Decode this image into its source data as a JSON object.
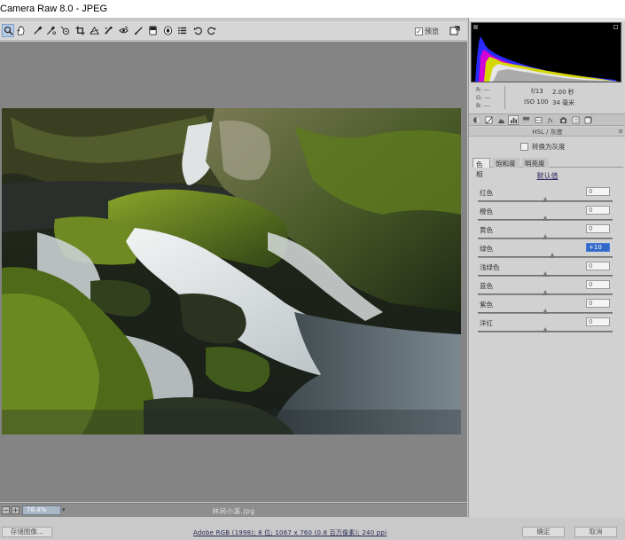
{
  "window": {
    "title": "Camera Raw 8.0 -  JPEG"
  },
  "toolbar": {
    "tools": [
      {
        "name": "zoom-tool",
        "icon": "magnifier-icon",
        "active": true
      },
      {
        "name": "hand-tool",
        "icon": "hand-icon"
      },
      {
        "name": "white-balance-tool",
        "icon": "eyedropper-icon"
      },
      {
        "name": "color-sampler-tool",
        "icon": "color-sampler-icon"
      },
      {
        "name": "targeted-adjustment-tool",
        "icon": "target-adjust-icon"
      },
      {
        "name": "crop-tool",
        "icon": "crop-icon"
      },
      {
        "name": "straighten-tool",
        "icon": "straighten-icon"
      },
      {
        "name": "spot-removal-tool",
        "icon": "spot-brush-icon"
      },
      {
        "name": "red-eye-tool",
        "icon": "red-eye-icon"
      },
      {
        "name": "adjustment-brush-tool",
        "icon": "brush-icon"
      },
      {
        "name": "graduated-filter-tool",
        "icon": "graduated-filter-icon"
      },
      {
        "name": "radial-filter-tool",
        "icon": "radial-filter-icon"
      },
      {
        "name": "preferences-button",
        "icon": "list-icon"
      },
      {
        "name": "rotate-left-button",
        "icon": "rotate-ccw-icon"
      },
      {
        "name": "rotate-right-button",
        "icon": "rotate-cw-icon"
      }
    ],
    "preview_label": "预览",
    "preview_checked": true,
    "fullscreen_icon": "fullscreen-icon"
  },
  "canvas": {
    "zoom_value": "78.4%",
    "filename": "林间小溪.jpg"
  },
  "bottom": {
    "save_label": "存储图像...",
    "workflow_text": "Adobe RGB (1998); 8 位; 1067 x 760 (0.8 百万像素); 240 ppi",
    "ok_label": "确定",
    "cancel_label": "取消"
  },
  "readout": {
    "r_label": "R:",
    "g_label": "G:",
    "b_label": "B:",
    "r_value": "---",
    "g_value": "---",
    "b_value": "---",
    "aperture": "f/13",
    "shutter": "2.00 秒",
    "iso": "ISO 100",
    "focal_length": "34 毫米"
  },
  "panel": {
    "tab_icons": [
      "basic-icon",
      "tone-curve-icon",
      "detail-icon",
      "hsl-icon",
      "split-toning-icon",
      "lens-icon",
      "fx-icon",
      "camera-calibration-icon",
      "presets-icon",
      "snapshots-icon"
    ],
    "active_tab_index": 3,
    "section_title": "HSL / 灰度",
    "convert_grayscale_label": "转换为灰度",
    "hsl_tabs": [
      "色相",
      "饱和度",
      "明亮度"
    ],
    "default_label": "默认值",
    "sliders": [
      {
        "label": "红色",
        "value": "0",
        "level": 0
      },
      {
        "label": "橙色",
        "value": "0",
        "level": 0
      },
      {
        "label": "黄色",
        "value": "0",
        "level": 0
      },
      {
        "label": "绿色",
        "value": "+10",
        "level": 10,
        "focused": true
      },
      {
        "label": "浅绿色",
        "value": "0",
        "level": 0
      },
      {
        "label": "蓝色",
        "value": "0",
        "level": 0
      },
      {
        "label": "紫色",
        "value": "0",
        "level": 0
      },
      {
        "label": "洋红",
        "value": "0",
        "level": 0
      }
    ],
    "slider_range": [
      -100,
      100
    ]
  },
  "colors": {
    "canvas_bg": "#848484",
    "panel_bg": "#d1d1d1",
    "focus_blue": "#2f68c6"
  }
}
